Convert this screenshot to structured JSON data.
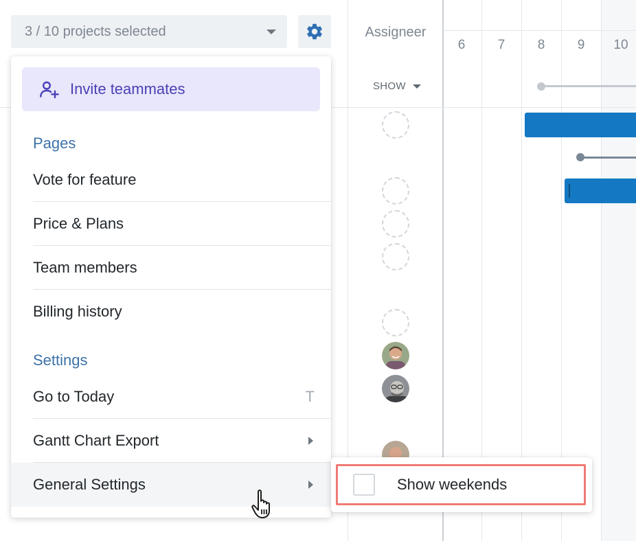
{
  "project_selector": {
    "label": "3 / 10 projects selected"
  },
  "gantt": {
    "assignee_header": "Assigneer",
    "show_dropdown": "SHOW",
    "days": [
      "6",
      "7",
      "8",
      "9",
      "10"
    ]
  },
  "menu": {
    "invite_label": "Invite teammates",
    "pages_title": "Pages",
    "pages": [
      "Vote for feature",
      "Price & Plans",
      "Team members",
      "Billing history"
    ],
    "settings_title": "Settings",
    "settings": {
      "today_label": "Go to Today",
      "today_shortcut": "T",
      "export_label": "Gantt Chart Export",
      "general_label": "General Settings"
    }
  },
  "submenu": {
    "show_weekends_label": "Show weekends",
    "show_weekends_checked": false
  },
  "colors": {
    "accent": "#3d72a8",
    "invite_bg": "#e8e7fb",
    "invite_text": "#4a3fb5",
    "bar": "#1479c2",
    "highlight": "#ef7a74"
  },
  "icons": [
    "chevron-down-icon",
    "gear-icon",
    "add-user-icon",
    "chevron-right-icon",
    "hand-pointer-icon"
  ]
}
